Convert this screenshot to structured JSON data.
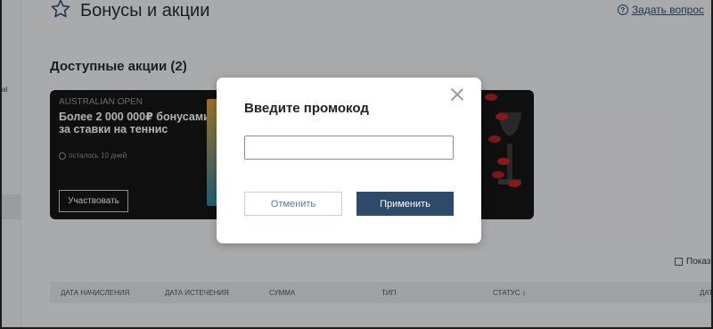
{
  "header": {
    "title": "Бонусы и акции",
    "ask_label": "Задать вопрос"
  },
  "sidebar": {
    "stub_text": "al"
  },
  "section": {
    "title": "Доступные акции (2)"
  },
  "promo": {
    "tag": "AUSTRALIAN OPEN",
    "headline": "Более 2 000 000₽ бонусами за ставки на теннис",
    "time_left": "осталось 10 дней",
    "join_label": "Участвовать"
  },
  "table": {
    "show_label": "Показ",
    "columns": [
      "ДАТА НАЧИСЛЕНИЯ",
      "ДАТА ИСТЕЧЕНИЯ",
      "СУММА",
      "ТИП",
      "СТАТУС ↕",
      "ДАТ"
    ]
  },
  "modal": {
    "title": "Введите промокод",
    "input_value": "",
    "input_placeholder": "",
    "cancel_label": "Отменить",
    "apply_label": "Применить"
  },
  "icons": {
    "star": "star-icon",
    "question": "question-icon",
    "clock": "clock-icon",
    "calendar": "calendar-icon",
    "close": "close-icon"
  },
  "colors": {
    "accent": "#2d4a6b",
    "link": "#2f4f76",
    "promo_bg": "#161616"
  }
}
